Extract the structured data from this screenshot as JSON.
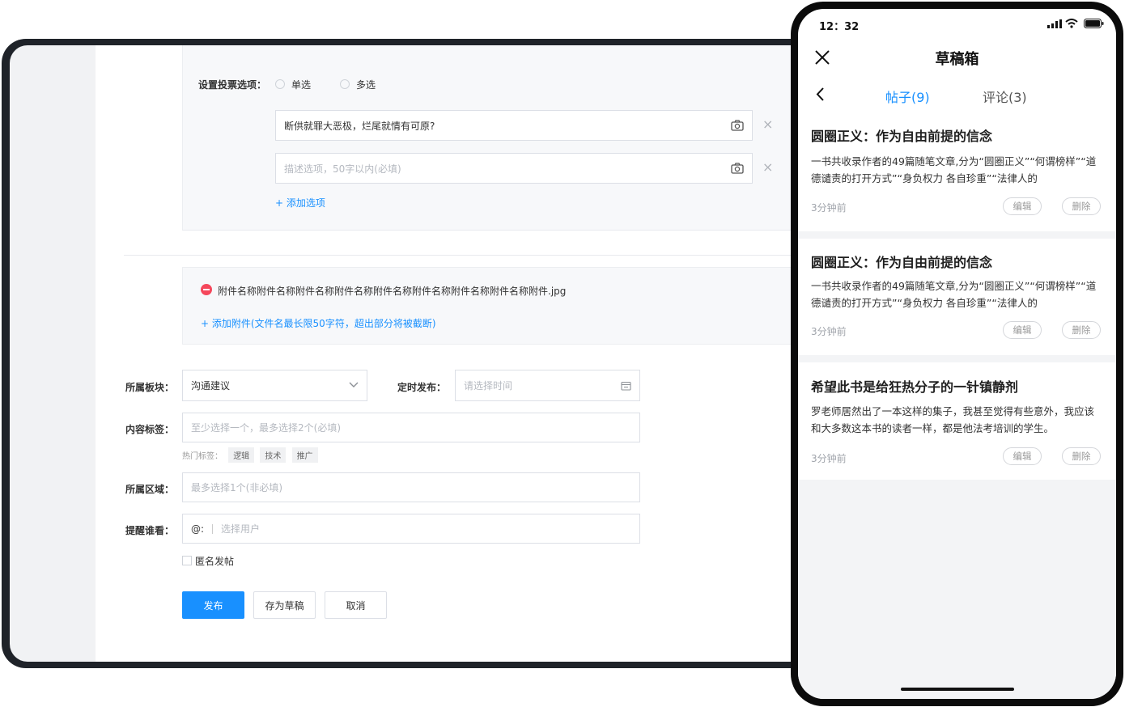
{
  "desktop": {
    "vote": {
      "label": "设置投票选项：",
      "single": "单选",
      "multi": "多选",
      "option1": "断供就罪大恶极，烂尾就情有可原?",
      "option2_placeholder": "描述选项，50字以内(必填)",
      "add_option": "+ 添加选项",
      "remove_symbol": "×"
    },
    "attachment": {
      "file_name": "附件名称附件名称附件名称附件名称附件名称附件名称附件名称附件名称附件.jpg",
      "add_label": "+ 添加附件(文件名最长限50字符，超出部分将被截断)"
    },
    "form": {
      "board_label": "所属板块：",
      "board_value": "沟通建议",
      "schedule_label": "定时发布：",
      "schedule_placeholder": "请选择时间",
      "tags_label": "内容标签：",
      "tags_placeholder": "至少选择一个，最多选择2个(必填)",
      "hot_tags_label": "热门标签：",
      "hot_tags": [
        "逻辑",
        "技术",
        "推广"
      ],
      "region_label": "所属区域：",
      "region_placeholder": "最多选择1个(非必填)",
      "remind_label": "提醒谁看：",
      "remind_prefix": "@:",
      "remind_placeholder": "选择用户",
      "anonymous_label": "匿名发帖"
    },
    "buttons": {
      "publish": "发布",
      "save_draft": "存为草稿",
      "cancel": "取消"
    },
    "colors": {
      "primary": "#1890ff",
      "danger": "#f5475b"
    }
  },
  "phone": {
    "status": {
      "time": "12：32"
    },
    "header": {
      "title": "草稿箱"
    },
    "tabs": [
      {
        "label": "帖子(9)",
        "active": true
      },
      {
        "label": "评论(3)",
        "active": false
      }
    ],
    "drafts": [
      {
        "title": "圆圈正义：作为自由前提的信念",
        "excerpt": "一书共收录作者的49篇随笔文章,分为“圆圈正义”“何谓榜样”“道德谴责的打开方式”“身负权力 各自珍重”“法律人的",
        "time": "3分钟前",
        "edit": "编辑",
        "delete": "删除"
      },
      {
        "title": "圆圈正义：作为自由前提的信念",
        "excerpt": "一书共收录作者的49篇随笔文章,分为“圆圈正义”“何谓榜样”“道德谴责的打开方式”“身负权力 各自珍重”“法律人的",
        "time": "3分钟前",
        "edit": "编辑",
        "delete": "删除"
      },
      {
        "title": "希望此书是给狂热分子的一针镇静剂",
        "excerpt": "罗老师居然出了一本这样的集子，我甚至觉得有些意外，我应该和大多数这本书的读者一样，都是他法考培训的学生。",
        "time": "3分钟前",
        "edit": "编辑",
        "delete": "删除"
      }
    ]
  }
}
